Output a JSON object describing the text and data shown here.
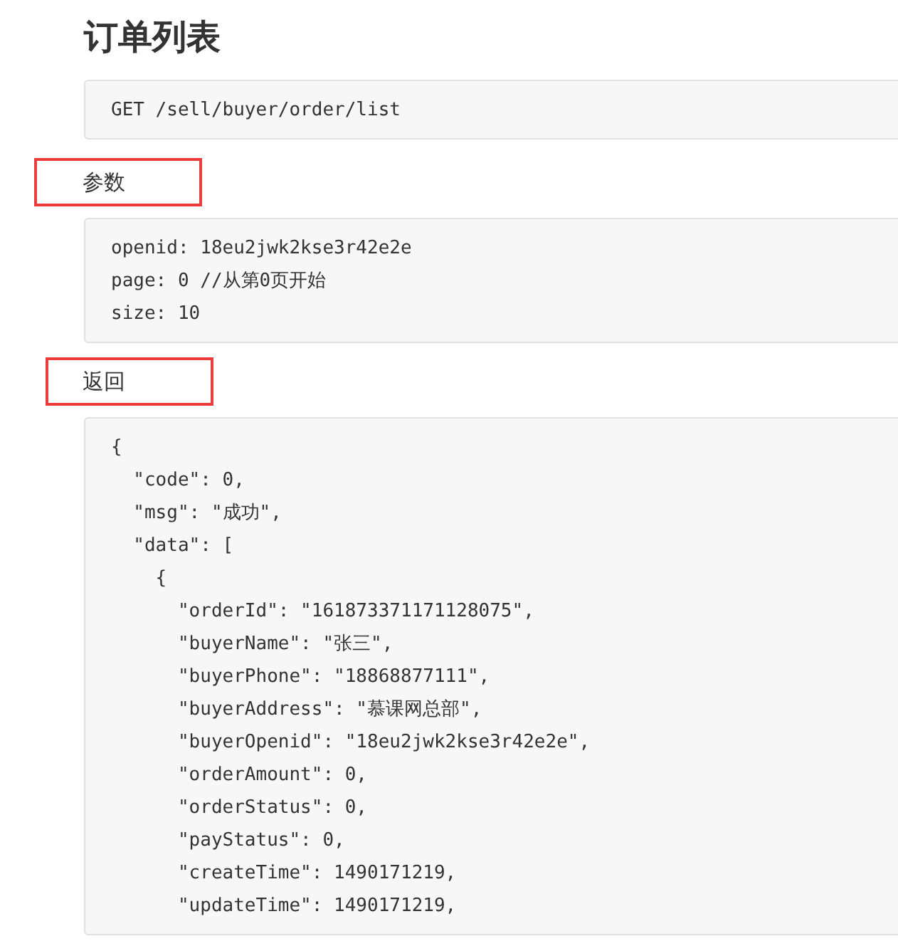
{
  "title": "订单列表",
  "endpoint": {
    "lines": [
      "GET /sell/buyer/order/list"
    ]
  },
  "sections": [
    {
      "heading": "参数",
      "code": {
        "lines": [
          "openid: 18eu2jwk2kse3r42e2e",
          "page: 0 //从第0页开始",
          "size: 10"
        ]
      }
    },
    {
      "heading": "返回",
      "code": {
        "lines": [
          "{",
          "  \"code\": 0,",
          "  \"msg\": \"成功\",",
          "  \"data\": [",
          "    {",
          "      \"orderId\": \"161873371171128075\",",
          "      \"buyerName\": \"张三\",",
          "      \"buyerPhone\": \"18868877111\",",
          "      \"buyerAddress\": \"慕课网总部\",",
          "      \"buyerOpenid\": \"18eu2jwk2kse3r42e2e\",",
          "      \"orderAmount\": 0,",
          "      \"orderStatus\": 0,",
          "      \"payStatus\": 0,",
          "      \"createTime\": 1490171219,",
          "      \"updateTime\": 1490171219,"
        ]
      }
    }
  ]
}
